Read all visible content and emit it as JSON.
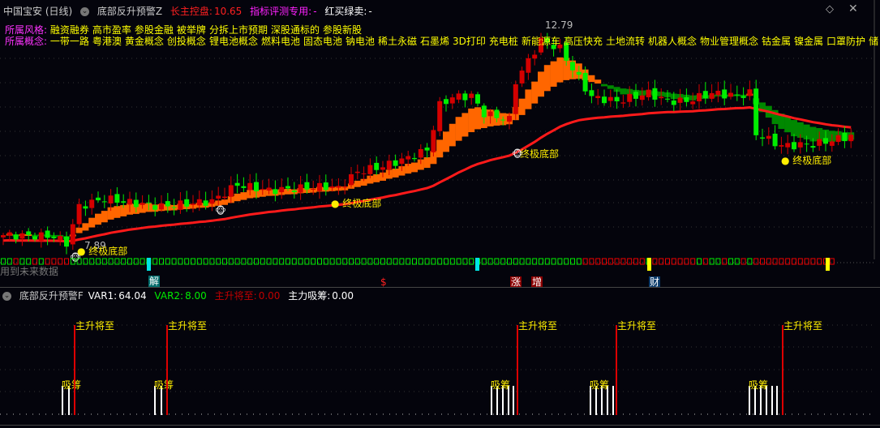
{
  "header": {
    "stock": "中国宝安 (日线)",
    "indicator": "底部反升预警Z",
    "long_control_label": "长主控盘:",
    "long_control_value": "10.65",
    "eval_label": "指标评测专用:",
    "eval_value": "-",
    "buy_sell_label": "红买绿卖:",
    "buy_sell_value": "-"
  },
  "styles": {
    "label": "所属风格:",
    "items": [
      "融资融券",
      "高市盈率",
      "参股金融",
      "被举牌",
      "分拆上市预期",
      "深股通标的",
      "参股新股"
    ]
  },
  "concepts": {
    "label": "所属概念:",
    "items": [
      "一带一路",
      "粤港澳",
      "黄金概念",
      "创投概念",
      "锂电池概念",
      "燃料电池",
      "固态电池",
      "钠电池",
      "稀土永磁",
      "石墨烯",
      "3D打印",
      "充电桩",
      "新能源车",
      "高压快充",
      "土地流转",
      "机器人概念",
      "物业管理概念",
      "钴金属",
      "镍金属",
      "口罩防护",
      "储"
    ]
  },
  "price_chart": {
    "low_label": "7.89",
    "high_label": "12.79",
    "low_price": 7.89,
    "high_price": 12.79,
    "price_path": [
      [
        0,
        8.07
      ],
      [
        8,
        8.04
      ],
      [
        10,
        7.89
      ],
      [
        12,
        8.71
      ],
      [
        16,
        8.89
      ],
      [
        20,
        8.8
      ],
      [
        25,
        8.71
      ],
      [
        33,
        8.83
      ],
      [
        37,
        9.2
      ],
      [
        42,
        9.07
      ],
      [
        51,
        9.16
      ],
      [
        53,
        9.12
      ],
      [
        56,
        9.49
      ],
      [
        60,
        9.61
      ],
      [
        64,
        9.8
      ],
      [
        67,
        9.98
      ],
      [
        69,
        10.98
      ],
      [
        71,
        11.16
      ],
      [
        74,
        11.19
      ],
      [
        76,
        10.79
      ],
      [
        80,
        10.65
      ],
      [
        81,
        11.52
      ],
      [
        83,
        11.97
      ],
      [
        85,
        12.43
      ],
      [
        88,
        12.25
      ],
      [
        90,
        11.79
      ],
      [
        93,
        11.16
      ],
      [
        97,
        11.07
      ],
      [
        102,
        11.25
      ],
      [
        105,
        11.07
      ],
      [
        108,
        11.07
      ],
      [
        112,
        11.25
      ],
      [
        116,
        11.19
      ],
      [
        118,
        11.25
      ],
      [
        119,
        10.34
      ],
      [
        123,
        10.07
      ],
      [
        128,
        10.1
      ],
      [
        134,
        10.29
      ]
    ],
    "bottom_label": "终极底部",
    "colors": {
      "up": "#d40000",
      "down": "#00ee00",
      "band_up": "#ff6600",
      "band_down": "#008800",
      "long_ma": "#ff1a1a"
    }
  },
  "signal_row": {
    "future_data_note": "用到未来数据",
    "markers": [
      {
        "text": "解",
        "color": "#ffffff",
        "bg": "#006b6b"
      },
      {
        "text": "$",
        "color": "#ff2020",
        "bg": "transparent"
      },
      {
        "text": "涨",
        "color": "#ffffff",
        "bg": "#8b0000"
      },
      {
        "text": "增",
        "color": "#ffffff",
        "bg": "#8b0000"
      },
      {
        "text": "财",
        "color": "#ffffff",
        "bg": "#0a3a6a"
      }
    ]
  },
  "lower_panel": {
    "indicator": "底部反升预警F",
    "var1_label": "VAR1:",
    "var1_value": "64.04",
    "var2_label": "VAR2:",
    "var2_value": "8.00",
    "main_rise_label": "主升将至:",
    "main_rise_value": "0.00",
    "absorb_label": "主力吸筹:",
    "absorb_value": "0.00",
    "signal_text": "主升将至",
    "absorb_text": "吸筹"
  },
  "window_icons": [
    "diamond-icon",
    "close-icon"
  ]
}
